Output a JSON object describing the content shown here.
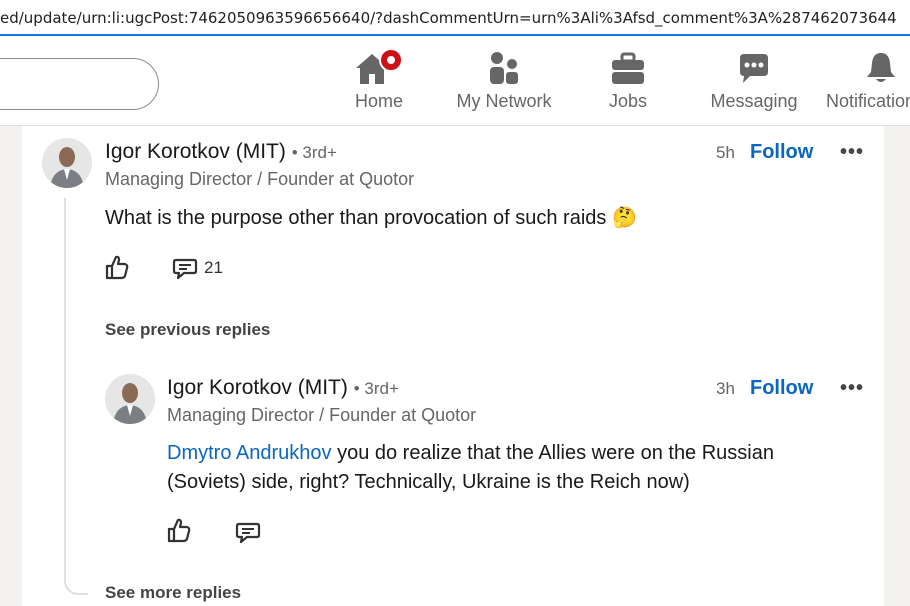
{
  "browser": {
    "url": "ed/update/urn:li:ugcPost:7462050963596656640/?dashCommentUrn=urn%3Ali%3Afsd_comment%3A%287462073644"
  },
  "nav": {
    "items": [
      {
        "label": "Home",
        "icon": "home-icon",
        "badge": true
      },
      {
        "label": "My Network",
        "icon": "network-icon"
      },
      {
        "label": "Jobs",
        "icon": "briefcase-icon"
      },
      {
        "label": "Messaging",
        "icon": "messaging-icon"
      },
      {
        "label": "Notifications",
        "icon": "bell-icon"
      }
    ]
  },
  "comment": {
    "author": "Igor Korotkov (MIT)",
    "degree": "• 3rd+",
    "headline": "Managing Director / Founder at Quotor",
    "time": "5h",
    "follow_label": "Follow",
    "more_label": "•••",
    "text": "What is the purpose other than provocation of such raids",
    "emoji": "🤔",
    "reply_count": "21",
    "see_previous": "See previous replies"
  },
  "reply": {
    "author": "Igor Korotkov (MIT)",
    "degree": "• 3rd+",
    "headline": "Managing Director / Founder at Quotor",
    "time": "3h",
    "follow_label": "Follow",
    "more_label": "•••",
    "mention": "Dmytro Andrukhov",
    "text": " you do realize that the Allies were on the Russian (Soviets) side, right? Technically, Ukraine is the Reich now)"
  },
  "see_more": "See more replies",
  "colors": {
    "accent": "#0a66c2",
    "badge": "#cc1016",
    "url_underline": "#1a73e8"
  }
}
